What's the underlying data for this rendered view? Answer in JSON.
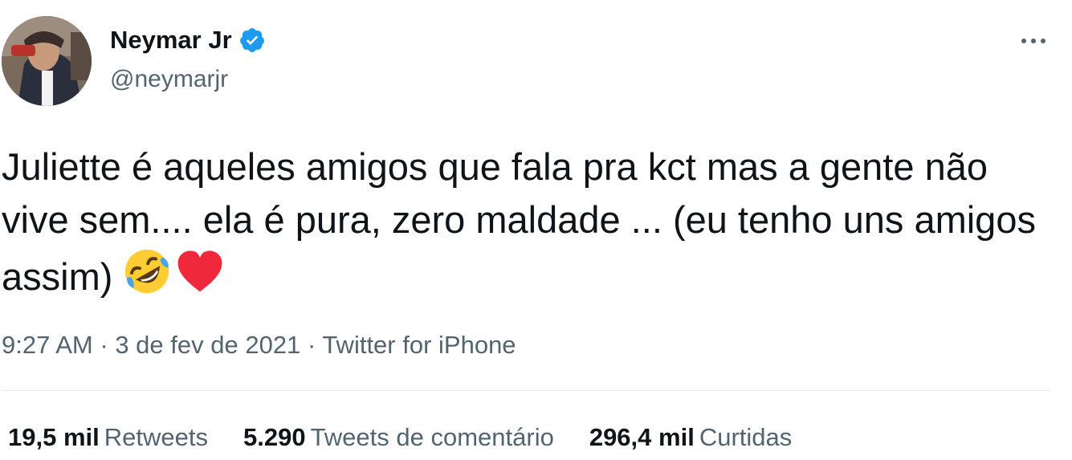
{
  "author": {
    "display_name": "Neymar Jr",
    "handle": "@neymarjr",
    "verified": true
  },
  "tweet": {
    "text": "Juliette é aqueles amigos que fala pra kct mas a gente não vive sem.... ela é pura, zero maldade ... (eu tenho uns amigos assim)",
    "emojis": [
      "rolling-on-floor-laughing",
      "red-heart"
    ]
  },
  "meta": {
    "time": "9:27 AM",
    "separator": "·",
    "date": "3 de fev de 2021",
    "source": "Twitter for iPhone"
  },
  "stats": {
    "retweets_count": "19,5 mil",
    "retweets_label": "Retweets",
    "replies_count": "5.290",
    "replies_label": "Tweets de comentário",
    "likes_count": "296,4 mil",
    "likes_label": "Curtidas"
  },
  "colors": {
    "text": "#0f1419",
    "secondary": "#536471",
    "verified": "#1d9bf0",
    "heart": "#f0283c",
    "divider": "#e6ecf0"
  }
}
